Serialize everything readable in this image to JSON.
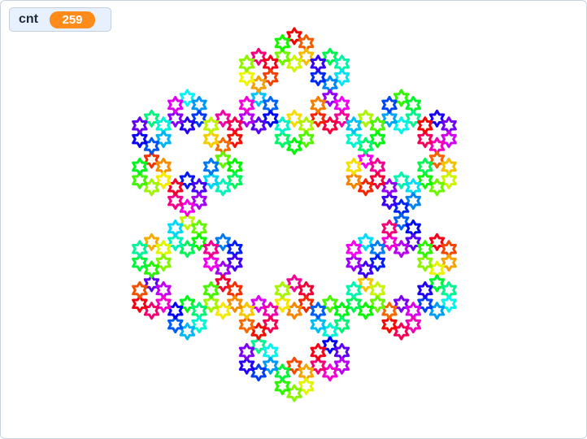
{
  "stage": {
    "monitor": {
      "label": "cnt",
      "value": "259"
    },
    "background_color": "#ffffff",
    "monitor_value_color": "#ff8c1a",
    "drawing": {
      "type": "hexagonal-star-fractal",
      "colors": "rainbow-hue-cycle"
    }
  }
}
